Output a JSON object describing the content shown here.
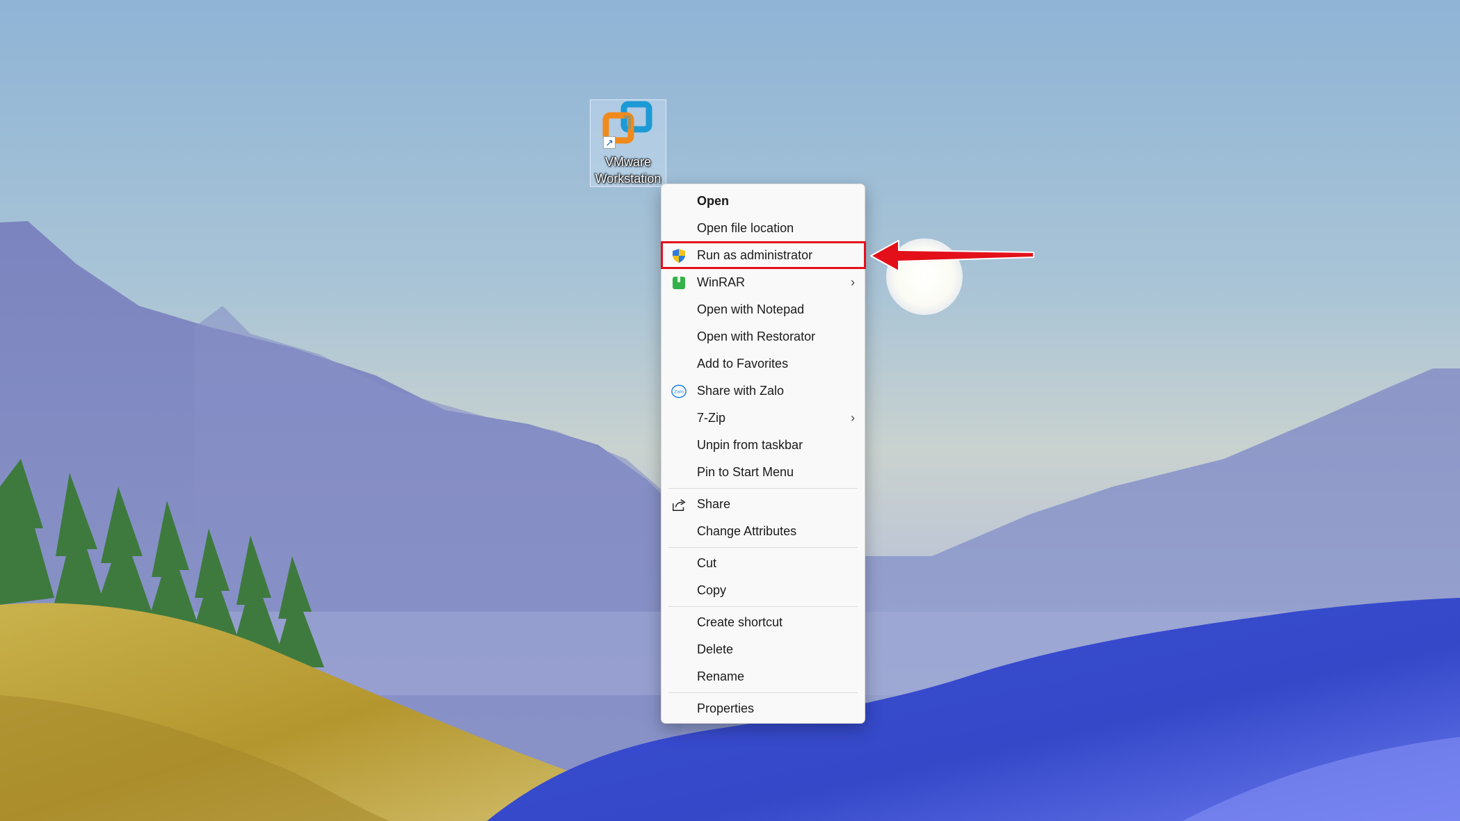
{
  "desktop": {
    "icon": {
      "name": "VMware Workstation",
      "label_lines": "VMware\nWorkstation"
    }
  },
  "context_menu": {
    "items": [
      {
        "label": "Open",
        "bold": true,
        "icon": "",
        "submenu": false
      },
      {
        "label": "Open file location",
        "icon": "",
        "submenu": false
      },
      {
        "label": "Run as administrator",
        "icon": "uac-shield-icon",
        "submenu": false,
        "highlighted": true
      },
      {
        "label": "WinRAR",
        "icon": "winrar-icon",
        "submenu": true
      },
      {
        "label": "Open with Notepad",
        "icon": "",
        "submenu": false
      },
      {
        "label": "Open with Restorator",
        "icon": "",
        "submenu": false
      },
      {
        "label": "Add to Favorites",
        "icon": "",
        "submenu": false
      },
      {
        "label": "Share with Zalo",
        "icon": "zalo-icon",
        "submenu": false
      },
      {
        "label": "7-Zip",
        "icon": "",
        "submenu": true
      },
      {
        "label": "Unpin from taskbar",
        "icon": "",
        "submenu": false
      },
      {
        "label": "Pin to Start Menu",
        "icon": "",
        "submenu": false
      },
      {
        "label": "Share",
        "icon": "share-icon",
        "submenu": false
      },
      {
        "label": "Change Attributes",
        "icon": "",
        "submenu": false
      },
      {
        "label": "Cut",
        "icon": "",
        "submenu": false
      },
      {
        "label": "Copy",
        "icon": "",
        "submenu": false
      },
      {
        "label": "Create shortcut",
        "icon": "",
        "submenu": false
      },
      {
        "label": "Delete",
        "icon": "",
        "submenu": false
      },
      {
        "label": "Rename",
        "icon": "",
        "submenu": false
      },
      {
        "label": "Properties",
        "icon": "",
        "submenu": false
      }
    ],
    "chevron": "›",
    "zalo_text": "Zalo"
  },
  "annotation": {
    "highlight_color": "#e3101a",
    "arrow_color": "#e3101a"
  }
}
